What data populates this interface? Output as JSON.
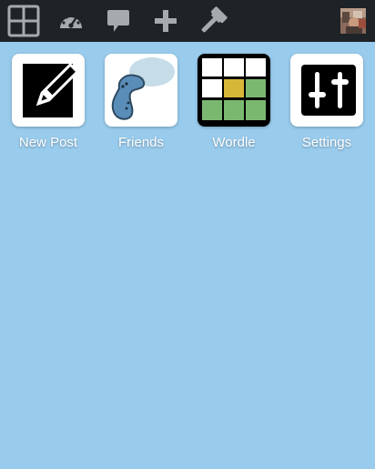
{
  "topbar": {
    "icons": [
      "apps-grid-icon",
      "dashboard-gauge-icon",
      "comment-bubble-icon",
      "plus-icon",
      "tools-hammer-icon"
    ],
    "avatar": "user-avatar"
  },
  "apps": [
    {
      "label": "New Post",
      "icon": "pencil-edit-icon"
    },
    {
      "label": "Friends",
      "icon": "friends-bird-icon"
    },
    {
      "label": "Wordle",
      "icon": "wordle-grid-icon"
    },
    {
      "label": "Settings",
      "icon": "sliders-icon"
    }
  ],
  "colors": {
    "background": "#99cbec",
    "topbar": "#1d2327",
    "topbar_icon": "#a7aaad",
    "wordle_green": "#6aaa64",
    "wordle_yellow": "#c9b458"
  }
}
